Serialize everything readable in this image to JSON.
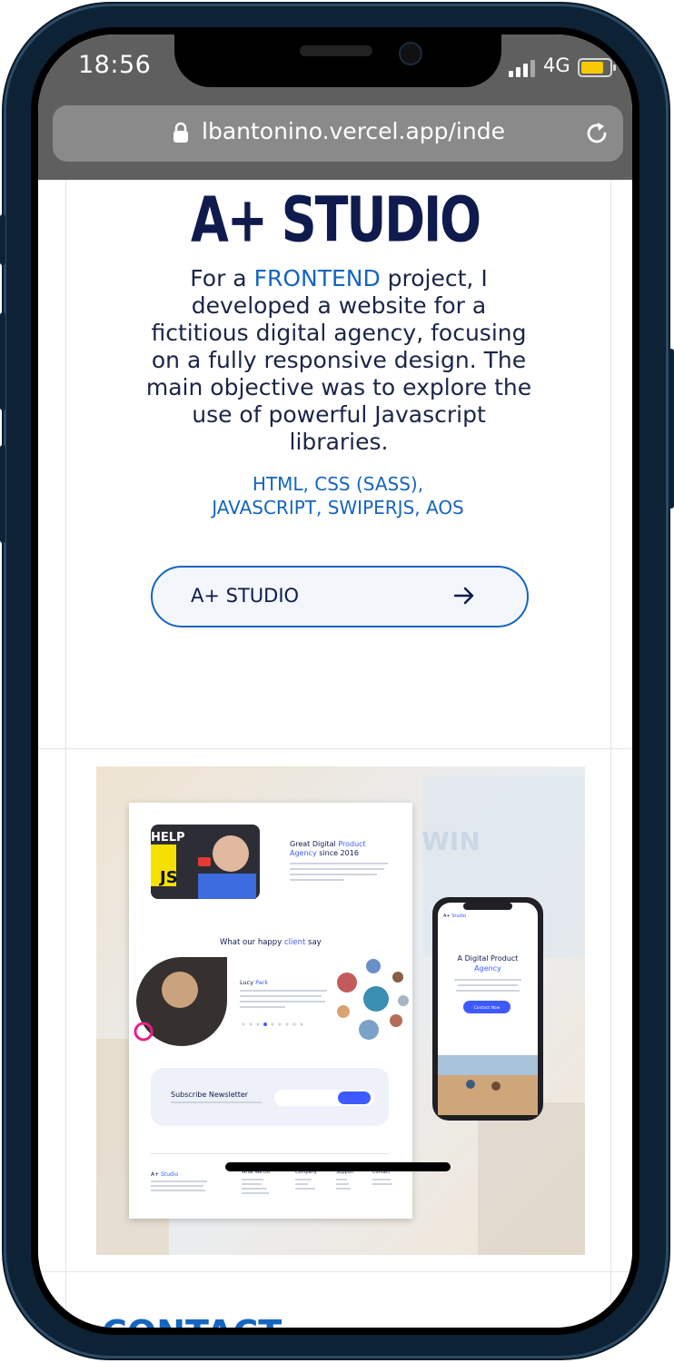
{
  "status_bar": {
    "time": "18:56",
    "network": "4G"
  },
  "browser": {
    "url": "lbantonino.vercel.app/inde",
    "icons": [
      "lock-icon",
      "reload-icon"
    ]
  },
  "project": {
    "title": "A+ STUDIO",
    "description_parts": [
      "For a ",
      "FRONTEND",
      " project, I developed a website for a fictitious digital agency, focusing on a fully responsive design. The main objective was to explore the use of powerful Javascript libraries."
    ],
    "tech_line1": "HTML, CSS (SASS),",
    "tech_line2": "JAVASCRIPT, SWIPERJS, AOS",
    "button_label": "A+ STUDIO",
    "button_icon": "arrow-right-icon"
  },
  "preview": {
    "hero_title_a": "Great Digital ",
    "hero_title_b": "Product",
    "hero_title_c": "Agency",
    "hero_title_d": " since 2016",
    "testimonial_heading_a": "What our happy ",
    "testimonial_heading_b": "client",
    "testimonial_heading_c": " say",
    "person_first": "Lucy ",
    "person_last": "Park",
    "newsletter": "Subscribe Newsletter",
    "footer_brand_a": "A+",
    "footer_brand_b": " Studio",
    "footer_cols": [
      "What We Do",
      "Company",
      "Support",
      "Contact"
    ],
    "phone_brand_a": "A+",
    "phone_brand_b": " Studio",
    "phone_title_a": "A Digital Product",
    "phone_title_b": "Agency",
    "phone_button": "Contact Now",
    "video_text": "HELP",
    "js_text": "JS",
    "wall_text": "WIN"
  },
  "next_section": {
    "heading": "CONTACT"
  },
  "colors": {
    "accent": "#1565c0",
    "navy": "#0f1b4d",
    "frame": "#0d2234"
  }
}
